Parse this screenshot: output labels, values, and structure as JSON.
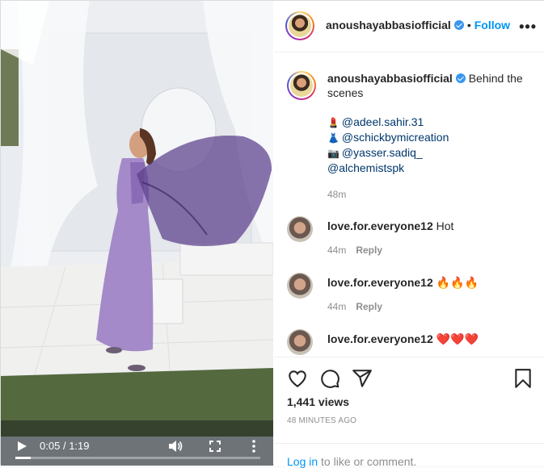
{
  "video": {
    "current_time": "0:05",
    "separator": "/",
    "duration": "1:19",
    "progress": 0.063
  },
  "header": {
    "username": "anoushayabbasiofficial",
    "separator": "•",
    "follow_label": "Follow",
    "more_icon": "more-horizontal-icon"
  },
  "caption": {
    "username": "anoushayabbasiofficial",
    "text": "Behind the scenes",
    "credits": [
      {
        "emoji": "💄",
        "handle": "@adeel.sahir.31"
      },
      {
        "emoji": "👗",
        "handle": "@schickbymicreation"
      },
      {
        "emoji": "📷",
        "handle": "@yasser.sadiq_"
      },
      {
        "emoji": "",
        "handle": "@alchemistspk"
      }
    ],
    "time": "48m"
  },
  "comments": [
    {
      "username": "love.for.everyone12",
      "text": "Hot",
      "time": "44m",
      "reply_label": "Reply"
    },
    {
      "username": "love.for.everyone12",
      "text": "🔥🔥🔥",
      "time": "44m",
      "reply_label": "Reply"
    },
    {
      "username": "love.for.everyone12",
      "text": "❤️❤️❤️",
      "time": "",
      "reply_label": ""
    }
  ],
  "actions": {
    "views": "1,441 views",
    "timestamp": "48 MINUTES AGO",
    "login_link": "Log in",
    "login_rest": " to like or comment."
  },
  "colors": {
    "accent": "#0095f6",
    "verified": "#3897f0",
    "heart": "#ed1c24"
  }
}
